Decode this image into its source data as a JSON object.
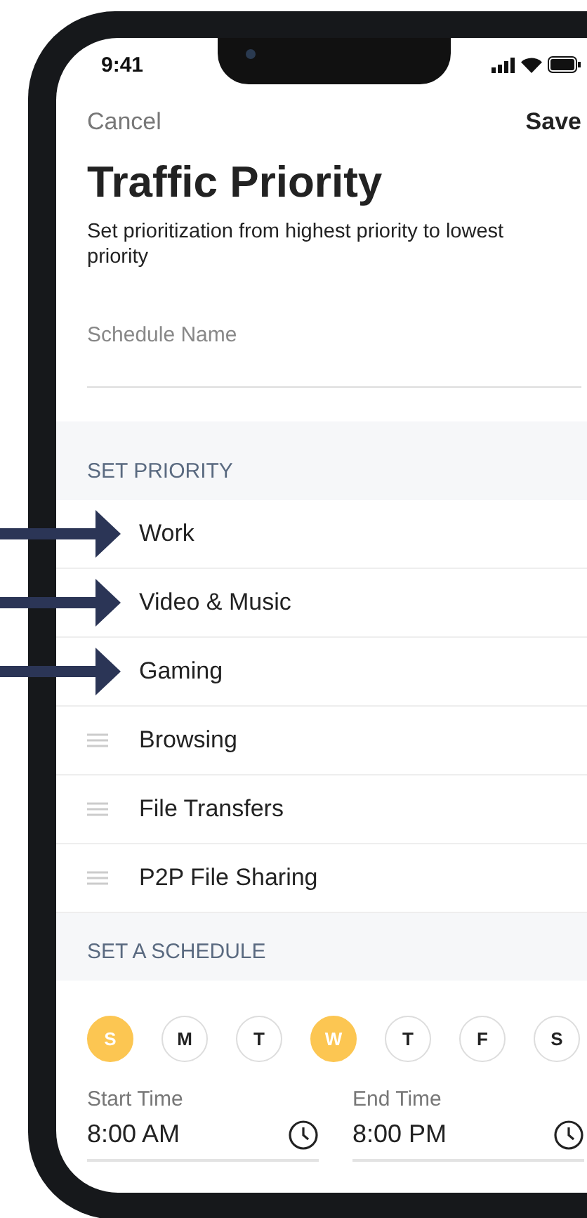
{
  "status_bar": {
    "time": "9:41"
  },
  "nav": {
    "cancel": "Cancel",
    "save": "Save"
  },
  "title": "Traffic Priority",
  "subtitle": "Set prioritization from highest priority to lowest priority",
  "schedule_name": {
    "placeholder": "Schedule Name"
  },
  "priority_section": {
    "heading": "SET PRIORITY",
    "items": [
      {
        "label": "Work",
        "marked": true
      },
      {
        "label": "Video & Music",
        "marked": true
      },
      {
        "label": "Gaming",
        "marked": true
      },
      {
        "label": "Browsing",
        "marked": false
      },
      {
        "label": "File Transfers",
        "marked": false
      },
      {
        "label": "P2P File Sharing",
        "marked": false
      }
    ]
  },
  "schedule_section": {
    "heading": "SET A SCHEDULE",
    "days": [
      {
        "label": "S",
        "selected": true
      },
      {
        "label": "M",
        "selected": false
      },
      {
        "label": "T",
        "selected": false
      },
      {
        "label": "W",
        "selected": true
      },
      {
        "label": "T",
        "selected": false
      },
      {
        "label": "F",
        "selected": false
      },
      {
        "label": "S",
        "selected": false
      }
    ],
    "times": [
      {
        "label": "Start Time",
        "value": "8:00 AM"
      },
      {
        "label": "End Time",
        "value": "8:00 PM"
      }
    ]
  }
}
